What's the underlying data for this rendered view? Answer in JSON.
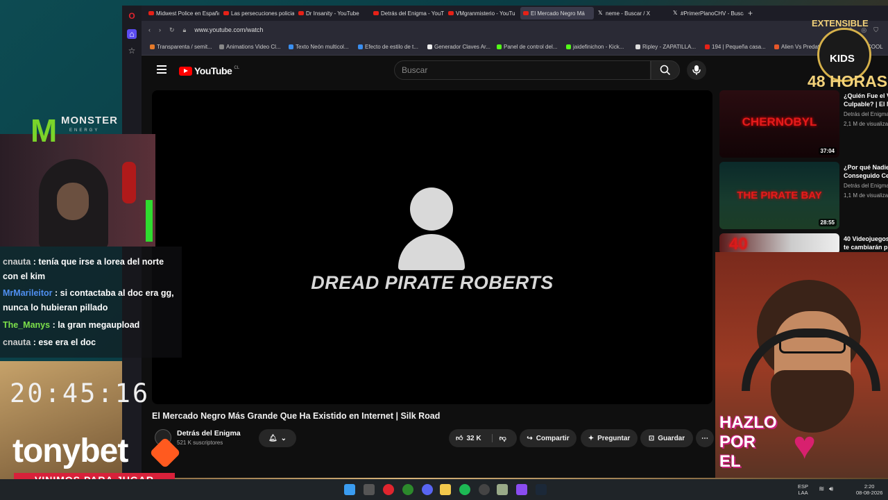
{
  "browser": {
    "tabs": [
      {
        "label": "Midwest Police en Españo",
        "icon": "youtube-icon"
      },
      {
        "label": "Las persecuciones policiac",
        "icon": "youtube-icon"
      },
      {
        "label": "Dr Insanity - YouTube",
        "icon": "youtube-icon"
      },
      {
        "label": "Detrás del Enigma - YouTu",
        "icon": "youtube-icon"
      },
      {
        "label": "VMgranmisterio - YouTu",
        "icon": "youtube-icon"
      },
      {
        "label": "El Mercado Negro Má",
        "icon": "youtube-icon",
        "active": true
      },
      {
        "label": "neme - Buscar / X",
        "icon": "x-icon"
      },
      {
        "label": "#PrimerPlanoCHV - Busca",
        "icon": "x-icon"
      }
    ],
    "url": "www.youtube.com/watch",
    "bookmarks": [
      "Transparenta / semit...",
      "Animations Video Cl...",
      "Texto Neón multicol...",
      "Efecto de estilo de t...",
      "Generador Claves Ar...",
      "Panel de control del...",
      "jaidefinichon - Kick...",
      "Ripley - ZAPATILLA...",
      "194 | Pequeña casa...",
      "Alien Vs Predator-alf...",
      "cre"
    ],
    "bookmark_end": "COOL"
  },
  "youtube": {
    "logo": "YouTube",
    "country": "CL",
    "search_placeholder": "Buscar",
    "video_overlay_text": "DREAD PIRATE ROBERTS",
    "title": "El Mercado Negro Más Grande Que Ha Existido en Internet | Silk Road",
    "channel": {
      "name": "Detrás del Enigma",
      "subs": "521 K suscriptores"
    },
    "likes": "32 K",
    "share": "Compartir",
    "ask": "Preguntar",
    "save": "Guardar",
    "sidebar": [
      {
        "thumb_text": "CHERNOBYL",
        "duration": "37:04",
        "title": "¿Quién Fue el V",
        "title2": "Culpable? | El M",
        "channel": "Detrás del Enigma",
        "views": "2,1 M de visualiza"
      },
      {
        "thumb_text": "THE PIRATE BAY",
        "duration": "28:55",
        "title": "¿Por qué Nadie",
        "title2": "Conseguido Ce",
        "channel": "Detrás del Enigma",
        "views": "1,1 M de visualiza"
      },
      {
        "thumb_text": "40",
        "duration": "",
        "title": "40 Videojuegos",
        "title2": "te cambiarán p",
        "channel": "",
        "views": ""
      }
    ]
  },
  "overlay": {
    "brand": "MONSTER",
    "brand_sub": "ENERGY",
    "chat": [
      {
        "user": "cnauta",
        "color": "#cfcfcf",
        "text": "tenía que irse a lorea del norte con el kim"
      },
      {
        "user": "MrMarileitor",
        "color": "#4f8ff0",
        "text": "si contactaba al doc era gg, nunca lo hubieran pillado"
      },
      {
        "user": "The_Manys",
        "color": "#7ce04a",
        "text": "la gran megaupload"
      },
      {
        "user": "cnauta",
        "color": "#cfcfcf",
        "text": "ese era el doc"
      }
    ],
    "clock": "20:45:16",
    "sponsor": "tonybet",
    "slogan": "VINIMOS PARA JUGAR",
    "badge_top": "EXTENSIBLE",
    "badge_word": "KIDS",
    "badge_bottom": "48 HORAS",
    "cta": [
      "HAZLO",
      "POR",
      "EL"
    ]
  },
  "taskbar": {
    "lang": "ESP",
    "lang2": "LAA",
    "time": "2:20",
    "date": "08-08-2026"
  }
}
